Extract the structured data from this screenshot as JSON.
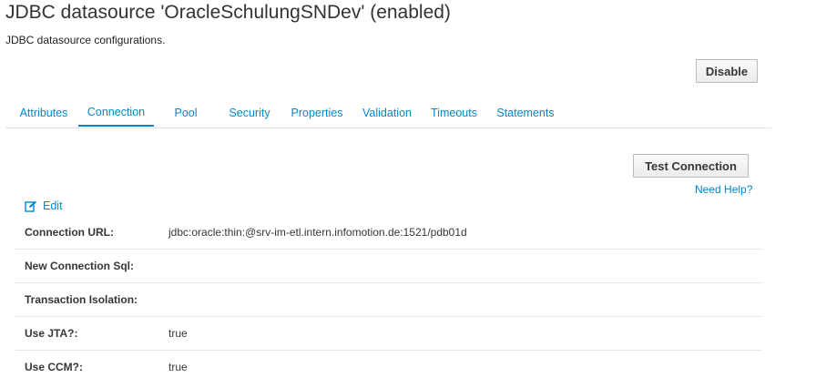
{
  "header": {
    "title": "JDBC datasource 'OracleSchulungSNDev' (enabled)",
    "description": "JDBC datasource configurations."
  },
  "actions": {
    "disable_label": "Disable",
    "test_connection_label": "Test Connection",
    "help_label": "Need Help?"
  },
  "tabs": [
    {
      "label": "Attributes",
      "active": false
    },
    {
      "label": "Connection",
      "active": true
    },
    {
      "label": "Pool",
      "active": false
    },
    {
      "label": "Security",
      "active": false
    },
    {
      "label": "Properties",
      "active": false
    },
    {
      "label": "Validation",
      "active": false
    },
    {
      "label": "Timeouts",
      "active": false
    },
    {
      "label": "Statements",
      "active": false
    }
  ],
  "edit": {
    "label": "Edit",
    "icon": "edit-icon"
  },
  "attributes": [
    {
      "label": "Connection URL:",
      "value": "jdbc:oracle:thin:@srv-im-etl.intern.infomotion.de:1521/pdb01d"
    },
    {
      "label": "New Connection Sql:",
      "value": ""
    },
    {
      "label": "Transaction Isolation:",
      "value": ""
    },
    {
      "label": "Use JTA?:",
      "value": "true"
    },
    {
      "label": "Use CCM?:",
      "value": "true"
    }
  ],
  "colors": {
    "link": "#0088ce",
    "text": "#363636",
    "divider": "#e6e6e6"
  }
}
